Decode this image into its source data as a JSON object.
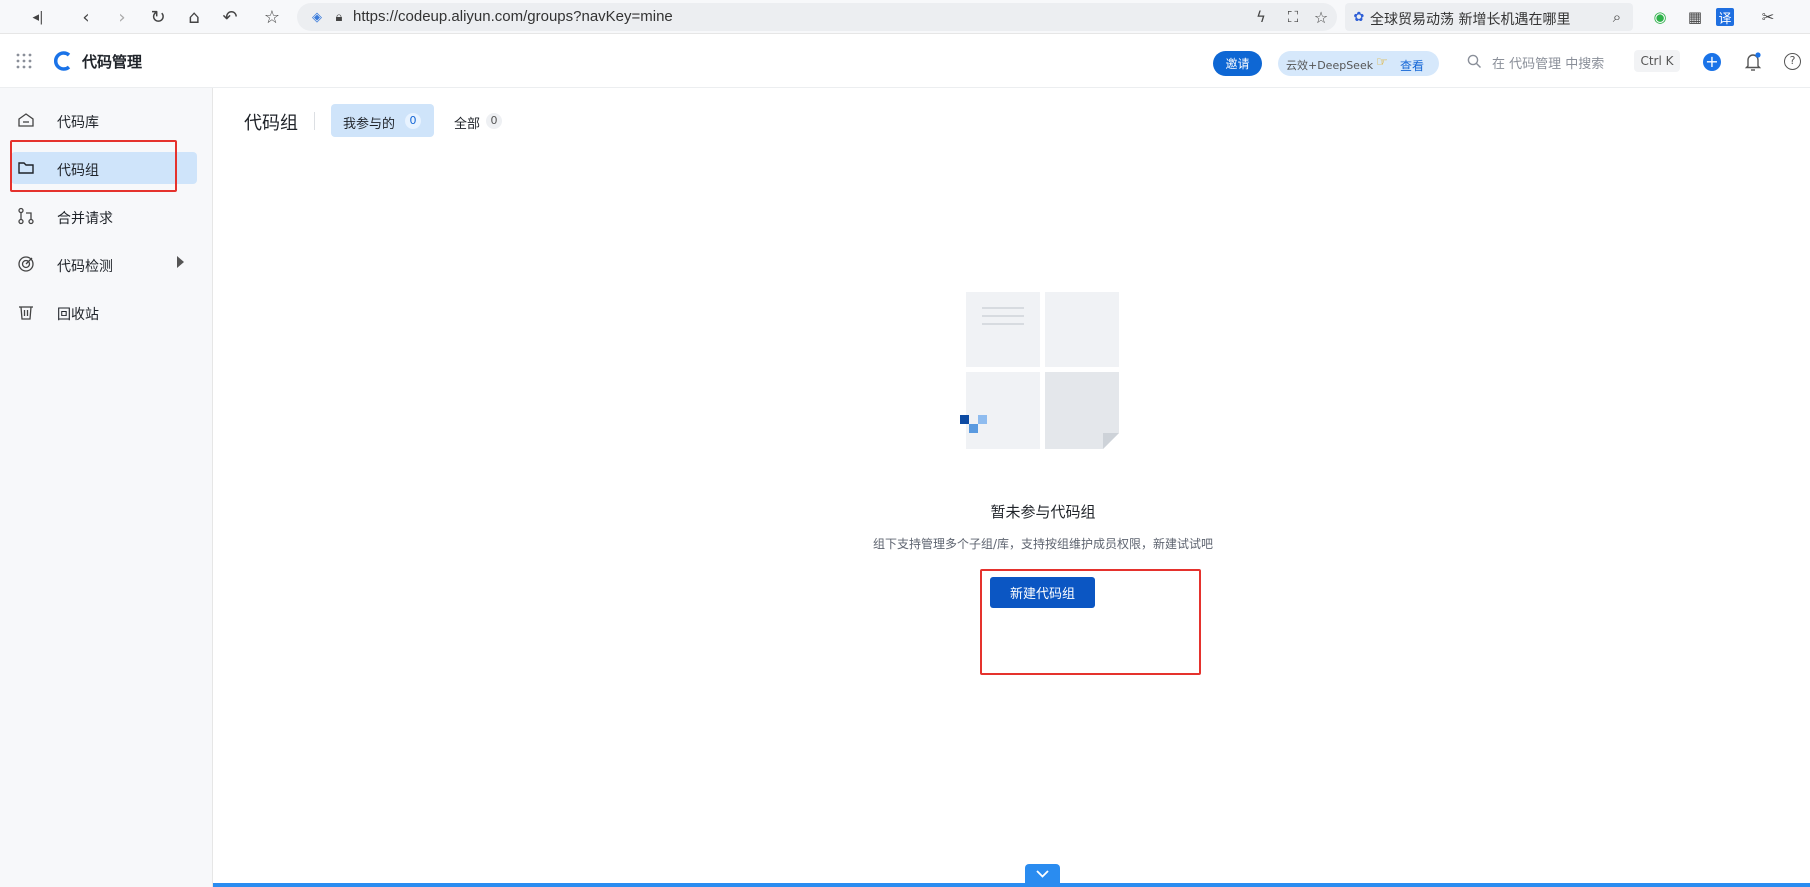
{
  "browser": {
    "url": "https://codeup.aliyun.com/groups?navKey=mine",
    "search_text": "全球贸易动荡 新增长机遇在哪里"
  },
  "header": {
    "app_name": "代码管理",
    "invite_label": "邀请",
    "promo_text": "云效+DeepSeek",
    "promo_link": "查看",
    "search_placeholder": "在 代码管理 中搜索",
    "shortcut": "Ctrl K"
  },
  "sidebar": {
    "items": [
      {
        "label": "代码库",
        "icon": "repo-icon",
        "active": false
      },
      {
        "label": "代码组",
        "icon": "folder-icon",
        "active": true
      },
      {
        "label": "合并请求",
        "icon": "merge-request-icon",
        "active": false
      },
      {
        "label": "代码检测",
        "icon": "scan-icon",
        "active": false
      },
      {
        "label": "回收站",
        "icon": "trash-icon",
        "active": false
      }
    ]
  },
  "main": {
    "title": "代码组",
    "tabs": [
      {
        "label": "我参与的",
        "count": "0",
        "active": true
      },
      {
        "label": "全部",
        "count": "0",
        "active": false
      }
    ],
    "empty_title": "暂未参与代码组",
    "empty_desc": "组下支持管理多个子组/库，支持按组维护成员权限，新建试试吧",
    "create_button": "新建代码组"
  },
  "colors": {
    "primary": "#0b56c3",
    "active_bg": "#cfe4fa",
    "annotation": "#e5322d"
  }
}
